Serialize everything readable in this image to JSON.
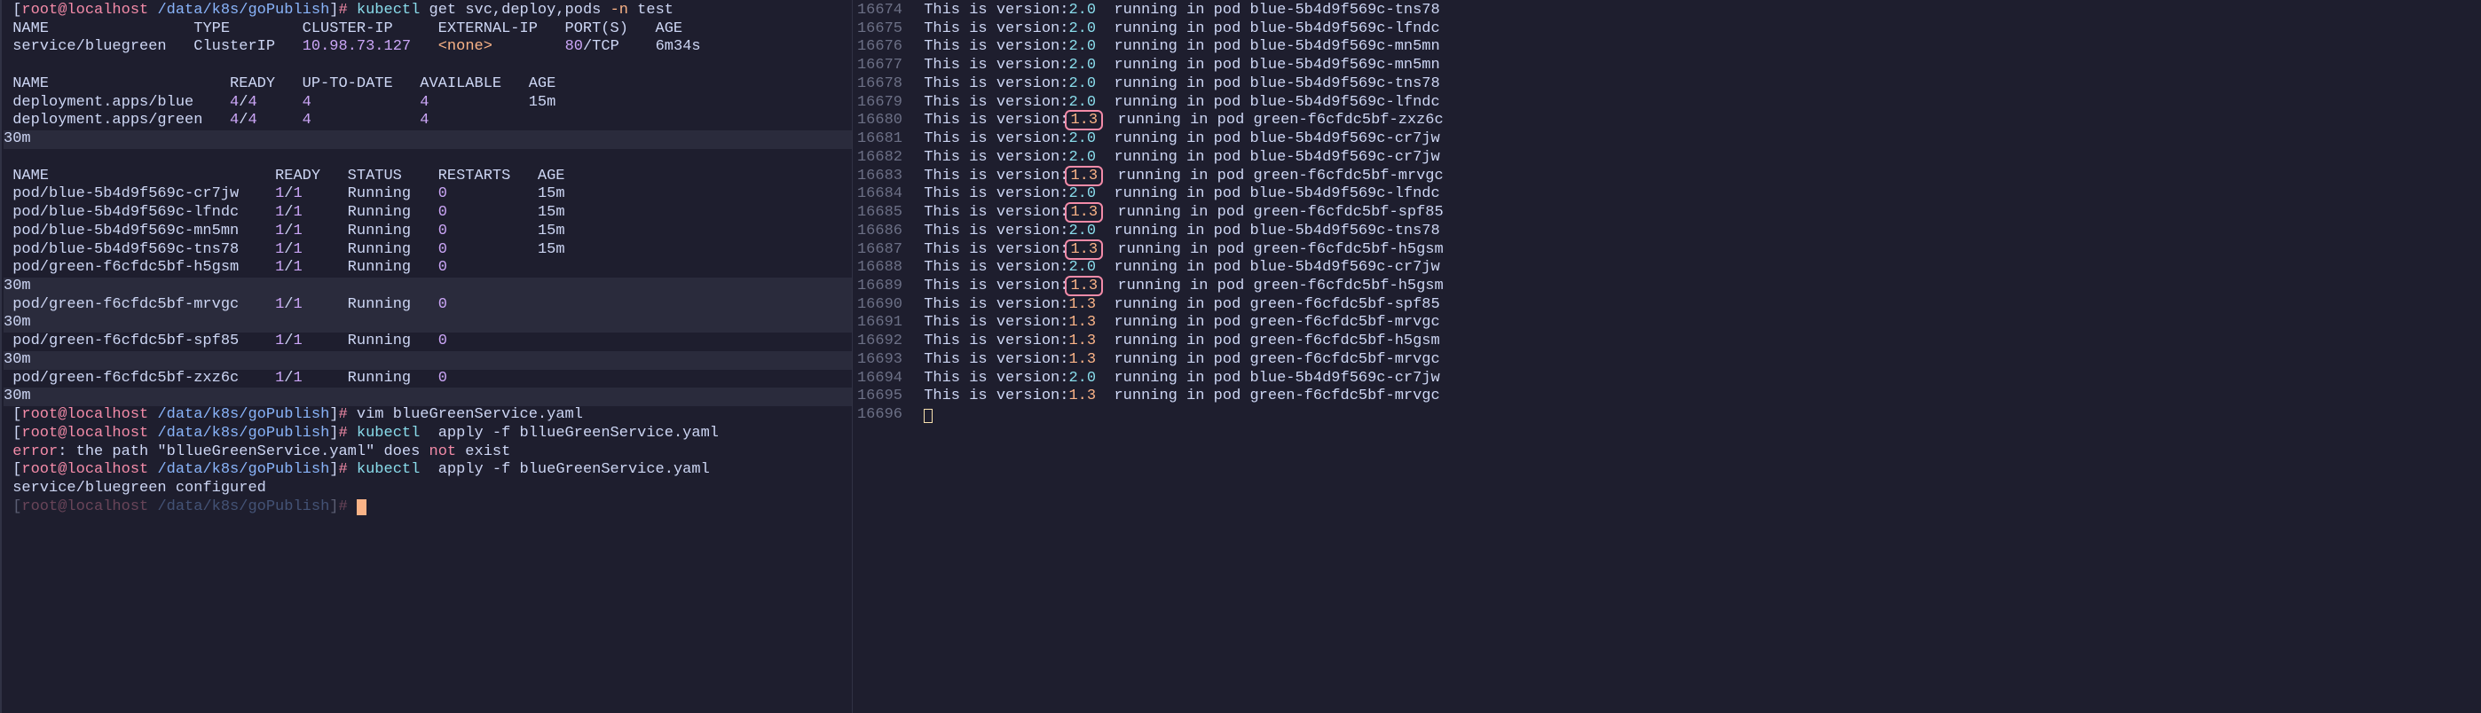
{
  "prompt": {
    "userhost": "root@localhost",
    "path": "/data/k8s/goPublish",
    "marker": "#"
  },
  "commands": {
    "cmd1": "kubectl get svc,deploy,pods -n test",
    "cmd1_kubectl": "kubectl",
    "cmd1_args": "get svc,deploy,pods",
    "cmd1_flag": "-n",
    "cmd1_ns": "test",
    "cmd2": "vim blueGreenService.yaml",
    "cmd3": "kubectl  apply -f bllueGreenService.yaml",
    "cmd3_kubectl": "kubectl",
    "cmd3_rest": "  apply -f bllueGreenService.yaml",
    "cmd4": "kubectl  apply -f blueGreenService.yaml",
    "cmd4_kubectl": "kubectl",
    "cmd4_rest": "  apply -f blueGreenService.yaml"
  },
  "svc": {
    "headers": "NAME                TYPE        CLUSTER-IP     EXTERNAL-IP   PORT(S)   AGE",
    "row_name": "service/bluegreen",
    "row_type": "ClusterIP",
    "row_ip": "10.98.73.127",
    "row_ext": "<none>",
    "row_port_a": "80",
    "row_port_b": "/TCP",
    "row_age": "6m34s"
  },
  "deploy": {
    "headers": "NAME                    READY   UP-TO-DATE   AVAILABLE   AGE",
    "rows": [
      {
        "name": "deployment.apps/blue",
        "ready_a": "4",
        "ready_b": "/",
        "ready_c": "4",
        "uptodate": "4",
        "avail": "4",
        "age": "15m",
        "age_hl": false
      },
      {
        "name": "deployment.apps/green",
        "ready_a": "4",
        "ready_b": "/",
        "ready_c": "4",
        "uptodate": "4",
        "avail": "4",
        "age": "30m",
        "age_hl": true
      }
    ]
  },
  "pods": {
    "headers": "NAME                         READY   STATUS    RESTARTS   AGE",
    "rows": [
      {
        "name": "pod/blue-5b4d9f569c-cr7jw",
        "ready_a": "1",
        "ready_b": "/",
        "ready_c": "1",
        "status": "Running",
        "restarts": "0",
        "age": "15m",
        "row_hl": false,
        "age_hl": false
      },
      {
        "name": "pod/blue-5b4d9f569c-lfndc",
        "ready_a": "1",
        "ready_b": "/",
        "ready_c": "1",
        "status": "Running",
        "restarts": "0",
        "age": "15m",
        "row_hl": false,
        "age_hl": false
      },
      {
        "name": "pod/blue-5b4d9f569c-mn5mn",
        "ready_a": "1",
        "ready_b": "/",
        "ready_c": "1",
        "status": "Running",
        "restarts": "0",
        "age": "15m",
        "row_hl": false,
        "age_hl": false
      },
      {
        "name": "pod/blue-5b4d9f569c-tns78",
        "ready_a": "1",
        "ready_b": "/",
        "ready_c": "1",
        "status": "Running",
        "restarts": "0",
        "age": "15m",
        "row_hl": false,
        "age_hl": false
      },
      {
        "name": "pod/green-f6cfdc5bf-h5gsm",
        "ready_a": "1",
        "ready_b": "/",
        "ready_c": "1",
        "status": "Running",
        "restarts": "0",
        "age": "30m",
        "row_hl": false,
        "age_hl": true
      },
      {
        "name": "pod/green-f6cfdc5bf-mrvgc",
        "ready_a": "1",
        "ready_b": "/",
        "ready_c": "1",
        "status": "Running",
        "restarts": "0",
        "age": "30m",
        "row_hl": true,
        "age_hl": true
      },
      {
        "name": "pod/green-f6cfdc5bf-spf85",
        "ready_a": "1",
        "ready_b": "/",
        "ready_c": "1",
        "status": "Running",
        "restarts": "0",
        "age": "30m",
        "row_hl": false,
        "age_hl": true
      },
      {
        "name": "pod/green-f6cfdc5bf-zxz6c",
        "ready_a": "1",
        "ready_b": "/",
        "ready_c": "1",
        "status": "Running",
        "restarts": "0",
        "age": "30m",
        "row_hl": false,
        "age_hl": true
      }
    ]
  },
  "error": {
    "label": "error",
    "msg1": ": the path \"bllueGreenService.yaml\" does ",
    "not": "not",
    "msg2": " exist"
  },
  "result": "service/bluegreen configured",
  "logs": [
    {
      "n": "16674",
      "v": "2.0",
      "boxed": false,
      "pod": "blue-5b4d9f569c-tns78"
    },
    {
      "n": "16675",
      "v": "2.0",
      "boxed": false,
      "pod": "blue-5b4d9f569c-lfndc"
    },
    {
      "n": "16676",
      "v": "2.0",
      "boxed": false,
      "pod": "blue-5b4d9f569c-mn5mn"
    },
    {
      "n": "16677",
      "v": "2.0",
      "boxed": false,
      "pod": "blue-5b4d9f569c-mn5mn"
    },
    {
      "n": "16678",
      "v": "2.0",
      "boxed": false,
      "pod": "blue-5b4d9f569c-tns78"
    },
    {
      "n": "16679",
      "v": "2.0",
      "boxed": false,
      "pod": "blue-5b4d9f569c-lfndc"
    },
    {
      "n": "16680",
      "v": "1.3",
      "boxed": true,
      "pod": "green-f6cfdc5bf-zxz6c"
    },
    {
      "n": "16681",
      "v": "2.0",
      "boxed": false,
      "pod": "blue-5b4d9f569c-cr7jw"
    },
    {
      "n": "16682",
      "v": "2.0",
      "boxed": false,
      "pod": "blue-5b4d9f569c-cr7jw"
    },
    {
      "n": "16683",
      "v": "1.3",
      "boxed": true,
      "pod": "green-f6cfdc5bf-mrvgc"
    },
    {
      "n": "16684",
      "v": "2.0",
      "boxed": false,
      "pod": "blue-5b4d9f569c-lfndc"
    },
    {
      "n": "16685",
      "v": "1.3",
      "boxed": true,
      "pod": "green-f6cfdc5bf-spf85"
    },
    {
      "n": "16686",
      "v": "2.0",
      "boxed": false,
      "pod": "blue-5b4d9f569c-tns78"
    },
    {
      "n": "16687",
      "v": "1.3",
      "boxed": true,
      "pod": "green-f6cfdc5bf-h5gsm"
    },
    {
      "n": "16688",
      "v": "2.0",
      "boxed": false,
      "pod": "blue-5b4d9f569c-cr7jw"
    },
    {
      "n": "16689",
      "v": "1.3",
      "boxed": true,
      "pod": "green-f6cfdc5bf-h5gsm"
    },
    {
      "n": "16690",
      "v": "1.3",
      "boxed": false,
      "pod": "green-f6cfdc5bf-spf85"
    },
    {
      "n": "16691",
      "v": "1.3",
      "boxed": false,
      "pod": "green-f6cfdc5bf-mrvgc"
    },
    {
      "n": "16692",
      "v": "1.3",
      "boxed": false,
      "pod": "green-f6cfdc5bf-h5gsm"
    },
    {
      "n": "16693",
      "v": "1.3",
      "boxed": false,
      "pod": "green-f6cfdc5bf-mrvgc"
    },
    {
      "n": "16694",
      "v": "2.0",
      "boxed": false,
      "pod": "blue-5b4d9f569c-cr7jw"
    },
    {
      "n": "16695",
      "v": "1.3",
      "boxed": false,
      "pod": "green-f6cfdc5bf-mrvgc"
    }
  ],
  "log_prefix": "This is version:",
  "log_mid": "  running in pod ",
  "last_linenum": "16696"
}
